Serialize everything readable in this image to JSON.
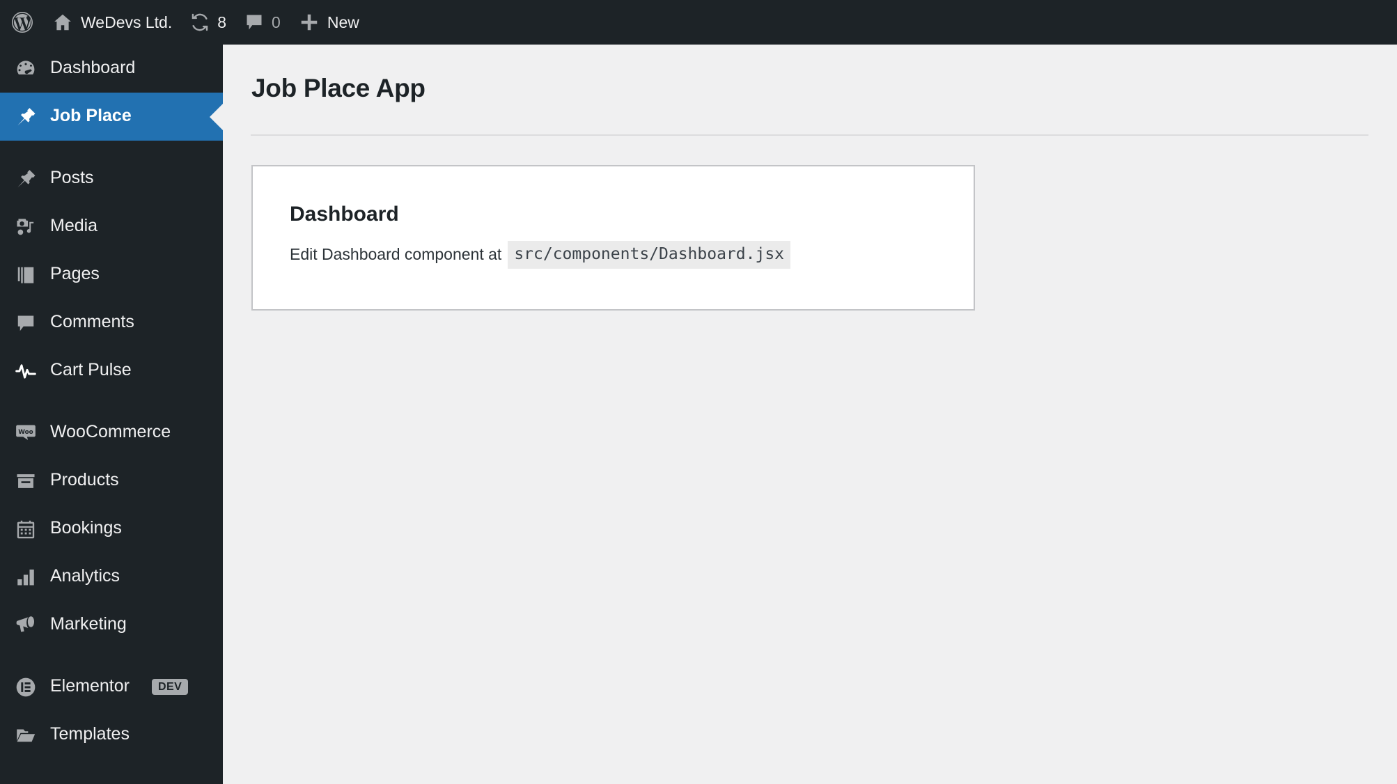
{
  "adminbar": {
    "wp_logo": "wordpress-logo",
    "site": {
      "icon": "home-icon",
      "label": "WeDevs Ltd."
    },
    "updates": {
      "icon": "updates-icon",
      "count": "8"
    },
    "comments": {
      "icon": "comment-bubble-icon",
      "count": "0"
    },
    "new": {
      "icon": "plus-icon",
      "label": "New"
    }
  },
  "sidebar": {
    "items": [
      {
        "label": "Dashboard",
        "icon": "dashboard-gauge-icon",
        "current": false,
        "separator_after": false
      },
      {
        "label": "Job Place",
        "icon": "pin-icon",
        "current": true,
        "separator_after": true
      },
      {
        "label": "Posts",
        "icon": "pin-icon",
        "current": false,
        "separator_after": false
      },
      {
        "label": "Media",
        "icon": "media-camera-music-icon",
        "current": false,
        "separator_after": false
      },
      {
        "label": "Pages",
        "icon": "pages-stack-icon",
        "current": false,
        "separator_after": false
      },
      {
        "label": "Comments",
        "icon": "comment-bubble-icon",
        "current": false,
        "separator_after": false
      },
      {
        "label": "Cart Pulse",
        "icon": "pulse-heartbeat-icon",
        "current": false,
        "separator_after": true
      },
      {
        "label": "WooCommerce",
        "icon": "woo-bubble-icon",
        "current": false,
        "separator_after": false
      },
      {
        "label": "Products",
        "icon": "products-box-icon",
        "current": false,
        "separator_after": false
      },
      {
        "label": "Bookings",
        "icon": "calendar-icon",
        "current": false,
        "separator_after": false
      },
      {
        "label": "Analytics",
        "icon": "bar-chart-icon",
        "current": false,
        "separator_after": false
      },
      {
        "label": "Marketing",
        "icon": "megaphone-icon",
        "current": false,
        "separator_after": true
      },
      {
        "label": "Elementor",
        "icon": "elementor-icon",
        "current": false,
        "badge": "DEV",
        "separator_after": false
      },
      {
        "label": "Templates",
        "icon": "folder-icon",
        "current": false,
        "separator_after": false
      }
    ]
  },
  "main": {
    "page_title": "Job Place App",
    "card": {
      "title": "Dashboard",
      "text": "Edit Dashboard component at",
      "code": "src/components/Dashboard.jsx"
    }
  },
  "colors": {
    "sidebar_bg": "#1d2327",
    "active_blue": "#2271b1",
    "content_bg": "#f0f0f1",
    "card_bg": "#ffffff",
    "card_border": "#c3c4c7",
    "icon_grey": "#a7aaad",
    "code_bg": "#ebebeb"
  }
}
